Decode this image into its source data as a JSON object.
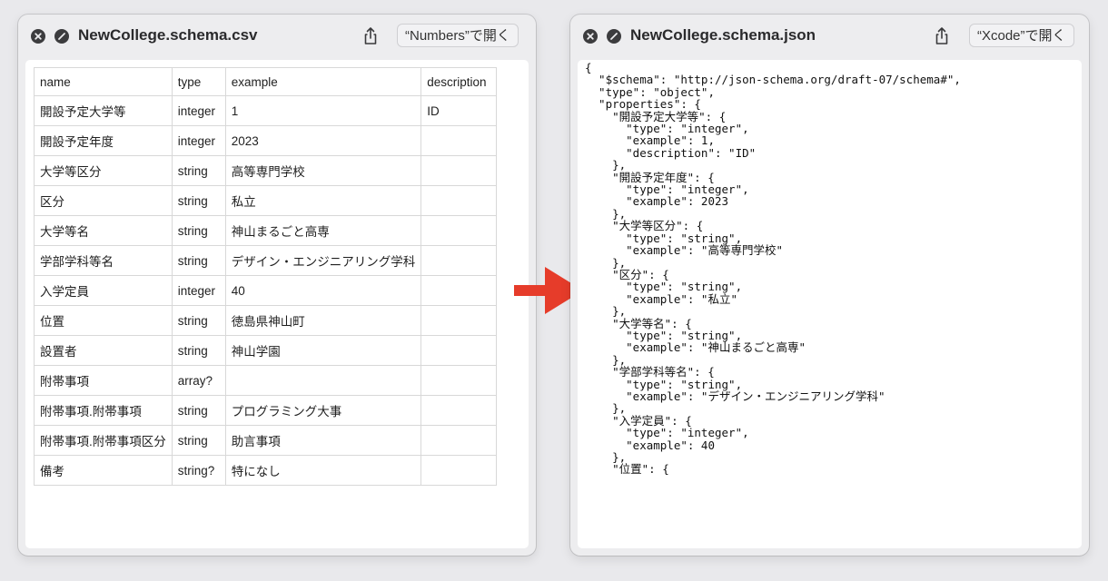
{
  "left_window": {
    "title": "NewCollege.schema.csv",
    "open_button": "“Numbers”で開く",
    "table": {
      "headers": [
        "name",
        "type",
        "example",
        "description"
      ],
      "rows": [
        [
          "開設予定大学等",
          "integer",
          "1",
          "ID"
        ],
        [
          "開設予定年度",
          "integer",
          "2023",
          ""
        ],
        [
          "大学等区分",
          "string",
          "高等専門学校",
          ""
        ],
        [
          "区分",
          "string",
          "私立",
          ""
        ],
        [
          "大学等名",
          "string",
          "神山まるごと高専",
          ""
        ],
        [
          "学部学科等名",
          "string",
          "デザイン・エンジニアリング学科",
          ""
        ],
        [
          "入学定員",
          "integer",
          "40",
          ""
        ],
        [
          "位置",
          "string",
          "徳島県神山町",
          ""
        ],
        [
          "設置者",
          "string",
          "神山学園",
          ""
        ],
        [
          "附帯事項",
          "array?",
          "",
          ""
        ],
        [
          "附帯事項.附帯事項",
          "string",
          "プログラミング大事",
          ""
        ],
        [
          "附帯事項.附帯事項区分",
          "string",
          "助言事項",
          ""
        ],
        [
          "備考",
          "string?",
          "特になし",
          ""
        ]
      ]
    }
  },
  "right_window": {
    "title": "NewCollege.schema.json",
    "open_button": "“Xcode”で開く",
    "code_lines": [
      "{",
      "  \"$schema\": \"http://json-schema.org/draft-07/schema#\",",
      "  \"type\": \"object\",",
      "  \"properties\": {",
      "    \"開設予定大学等\": {",
      "      \"type\": \"integer\",",
      "      \"example\": 1,",
      "      \"description\": \"ID\"",
      "    },",
      "    \"開設予定年度\": {",
      "      \"type\": \"integer\",",
      "      \"example\": 2023",
      "    },",
      "    \"大学等区分\": {",
      "      \"type\": \"string\",",
      "      \"example\": \"高等専門学校\"",
      "    },",
      "    \"区分\": {",
      "      \"type\": \"string\",",
      "      \"example\": \"私立\"",
      "    },",
      "    \"大学等名\": {",
      "      \"type\": \"string\",",
      "      \"example\": \"神山まるごと高専\"",
      "    },",
      "    \"学部学科等名\": {",
      "      \"type\": \"string\",",
      "      \"example\": \"デザイン・エンジニアリング学科\"",
      "    },",
      "    \"入学定員\": {",
      "      \"type\": \"integer\",",
      "      \"example\": 40",
      "    },",
      "    \"位置\": {"
    ]
  },
  "icons": {
    "close": "close-icon",
    "minimize": "minimize-icon",
    "share": "share-icon",
    "arrow": "right-arrow-icon"
  },
  "colors": {
    "arrow": "#e63c2a",
    "window_bg": "#ededef",
    "content_bg": "#ffffff"
  }
}
